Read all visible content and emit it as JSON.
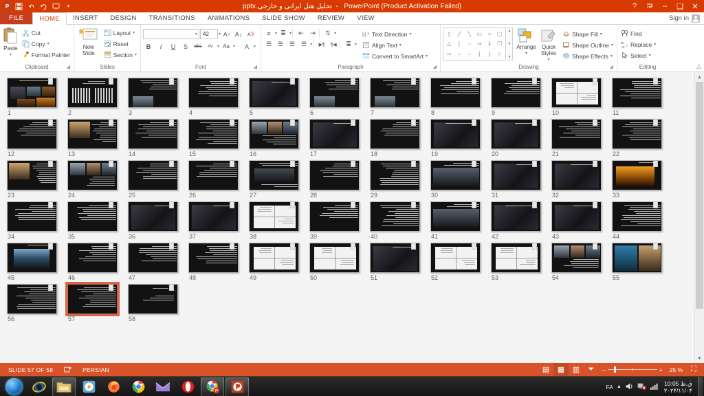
{
  "titlebar": {
    "file_name_fa": "تحلیل هتل ایرانی و خارجی.pptx",
    "app_suffix": "PowerPoint (Product Activation Failed)",
    "qat": [
      {
        "name": "app-icon",
        "glyph": "P"
      },
      {
        "name": "save-icon",
        "glyph": "💾"
      },
      {
        "name": "undo-icon",
        "glyph": "↶"
      },
      {
        "name": "redo-icon",
        "glyph": "↻"
      },
      {
        "name": "start-slideshow-icon",
        "glyph": "❐"
      },
      {
        "name": "customize-qat-icon",
        "glyph": "≡"
      }
    ],
    "window_controls": [
      {
        "name": "help",
        "glyph": "?"
      },
      {
        "name": "ribbon-display-options",
        "glyph": "⬒"
      },
      {
        "name": "minimize",
        "glyph": "–"
      },
      {
        "name": "restore",
        "glyph": "❐"
      },
      {
        "name": "close",
        "glyph": "✕"
      }
    ]
  },
  "tabs": [
    {
      "label": "FILE",
      "active": false,
      "file": true
    },
    {
      "label": "HOME",
      "active": true
    },
    {
      "label": "INSERT",
      "active": false
    },
    {
      "label": "DESIGN",
      "active": false
    },
    {
      "label": "TRANSITIONS",
      "active": false
    },
    {
      "label": "ANIMATIONS",
      "active": false
    },
    {
      "label": "SLIDE SHOW",
      "active": false
    },
    {
      "label": "REVIEW",
      "active": false
    },
    {
      "label": "VIEW",
      "active": false
    }
  ],
  "signin": {
    "label": "Sign in"
  },
  "ribbon": {
    "clipboard": {
      "group_label": "Clipboard",
      "paste_label": "Paste",
      "items": [
        {
          "label": "Cut",
          "icon": "scissors-icon"
        },
        {
          "label": "Copy",
          "icon": "copy-icon"
        },
        {
          "label": "Format Painter",
          "icon": "format-painter-icon"
        }
      ]
    },
    "slides": {
      "group_label": "Slides",
      "new_slide_label": "New Slide",
      "items": [
        {
          "label": "Layout",
          "icon": "layout-icon"
        },
        {
          "label": "Reset",
          "icon": "reset-icon"
        },
        {
          "label": "Section",
          "icon": "section-icon"
        }
      ]
    },
    "font": {
      "group_label": "Font",
      "font_name": "",
      "font_name_placeholder": "",
      "font_size": "42",
      "buttons": [
        "B",
        "I",
        "U",
        "S",
        "abc",
        "AV",
        "Aa",
        "A"
      ]
    },
    "paragraph": {
      "group_label": "Paragraph",
      "items": [
        {
          "label": "Text Direction",
          "icon": "text-direction-icon"
        },
        {
          "label": "Align Text",
          "icon": "align-text-icon"
        },
        {
          "label": "Convert to SmartArt",
          "icon": "smartart-icon"
        }
      ]
    },
    "drawing": {
      "group_label": "Drawing",
      "arrange_label": "Arrange",
      "quick_styles_label": "Quick Styles",
      "items": [
        {
          "label": "Shape Fill",
          "icon": "shape-fill-icon"
        },
        {
          "label": "Shape Outline",
          "icon": "shape-outline-icon"
        },
        {
          "label": "Shape Effects",
          "icon": "shape-effects-icon"
        }
      ]
    },
    "editing": {
      "group_label": "Editing",
      "items": [
        {
          "label": "Find",
          "icon": "find-icon"
        },
        {
          "label": "Replace",
          "icon": "replace-icon"
        },
        {
          "label": "Select",
          "icon": "select-icon"
        }
      ]
    }
  },
  "sorter": {
    "selected_slide": 57,
    "total_slides": 58,
    "slides": [
      {
        "n": 1,
        "kind": "title-images"
      },
      {
        "n": 2,
        "kind": "columns"
      },
      {
        "n": 3,
        "kind": "text-photo"
      },
      {
        "n": 4,
        "kind": "text"
      },
      {
        "n": 5,
        "kind": "photo-dark"
      },
      {
        "n": 6,
        "kind": "text-photo"
      },
      {
        "n": 7,
        "kind": "text-photo"
      },
      {
        "n": 8,
        "kind": "text"
      },
      {
        "n": 9,
        "kind": "text"
      },
      {
        "n": 10,
        "kind": "plan"
      },
      {
        "n": 11,
        "kind": "text"
      },
      {
        "n": 12,
        "kind": "text"
      },
      {
        "n": 13,
        "kind": "photo-left"
      },
      {
        "n": 14,
        "kind": "text"
      },
      {
        "n": 15,
        "kind": "text"
      },
      {
        "n": 16,
        "kind": "photo-grid"
      },
      {
        "n": 17,
        "kind": "photo-dark"
      },
      {
        "n": 18,
        "kind": "text"
      },
      {
        "n": 19,
        "kind": "photo-dark"
      },
      {
        "n": 20,
        "kind": "photo-dark"
      },
      {
        "n": 21,
        "kind": "text"
      },
      {
        "n": 22,
        "kind": "text"
      },
      {
        "n": 23,
        "kind": "photo-left"
      },
      {
        "n": 24,
        "kind": "photo-grid"
      },
      {
        "n": 25,
        "kind": "text"
      },
      {
        "n": 26,
        "kind": "text"
      },
      {
        "n": 27,
        "kind": "photo-top"
      },
      {
        "n": 28,
        "kind": "text"
      },
      {
        "n": 29,
        "kind": "text"
      },
      {
        "n": 30,
        "kind": "photo-wide"
      },
      {
        "n": 31,
        "kind": "photo-dark"
      },
      {
        "n": 32,
        "kind": "photo-dark"
      },
      {
        "n": 33,
        "kind": "photo-orange"
      },
      {
        "n": 34,
        "kind": "text"
      },
      {
        "n": 35,
        "kind": "text"
      },
      {
        "n": 36,
        "kind": "photo-dark"
      },
      {
        "n": 37,
        "kind": "photo-dark"
      },
      {
        "n": 38,
        "kind": "plan"
      },
      {
        "n": 39,
        "kind": "text"
      },
      {
        "n": 40,
        "kind": "text"
      },
      {
        "n": 41,
        "kind": "photo-wide"
      },
      {
        "n": 42,
        "kind": "photo-dark"
      },
      {
        "n": 43,
        "kind": "photo-dark"
      },
      {
        "n": 44,
        "kind": "text"
      },
      {
        "n": 45,
        "kind": "photo-building"
      },
      {
        "n": 46,
        "kind": "text"
      },
      {
        "n": 47,
        "kind": "text"
      },
      {
        "n": 48,
        "kind": "text"
      },
      {
        "n": 49,
        "kind": "plan"
      },
      {
        "n": 50,
        "kind": "plan"
      },
      {
        "n": 51,
        "kind": "photo-dark"
      },
      {
        "n": 52,
        "kind": "plan"
      },
      {
        "n": 53,
        "kind": "plan"
      },
      {
        "n": 54,
        "kind": "photo-grid"
      },
      {
        "n": 55,
        "kind": "photo-pool"
      },
      {
        "n": 56,
        "kind": "text"
      },
      {
        "n": 57,
        "kind": "text"
      },
      {
        "n": 58,
        "kind": "text-short"
      }
    ]
  },
  "statusbar": {
    "slide_indicator": "SLIDE 57 OF 58",
    "language": "PERSIAN",
    "notes_icon": "notes-icon",
    "views": [
      {
        "name": "normal-view",
        "glyph": "▤",
        "active": false
      },
      {
        "name": "slide-sorter-view",
        "glyph": "▦",
        "active": true
      },
      {
        "name": "reading-view",
        "glyph": "▥",
        "active": false
      },
      {
        "name": "slideshow-view",
        "glyph": "▷",
        "active": false
      }
    ],
    "zoom_out": "–",
    "zoom_in": "+",
    "zoom_value": "25 %",
    "fit_icon": "fit-to-window-icon"
  },
  "taskbar": {
    "start_label": "Start",
    "items": [
      {
        "name": "internet-explorer-icon",
        "pinned": true
      },
      {
        "name": "file-explorer-icon",
        "pinned": true,
        "running": true
      },
      {
        "name": "media-player-icon",
        "pinned": true
      },
      {
        "name": "firefox-icon",
        "pinned": true
      },
      {
        "name": "chrome-icon",
        "pinned": true
      },
      {
        "name": "mail-icon",
        "pinned": true
      },
      {
        "name": "opera-icon",
        "pinned": true
      },
      {
        "name": "chrome-beta-icon",
        "running": true
      },
      {
        "name": "powerpoint-icon",
        "running": true
      }
    ],
    "tray": {
      "language": "FA",
      "show_hidden_icon": "chevron-up-icon",
      "volume_icon": "speaker-icon",
      "network_icon": "network-error-icon",
      "signal_icon": "signal-icon",
      "time": "10:05 ق.ظ",
      "date": "۲۰۲۴/۱۱/۰۴"
    }
  }
}
